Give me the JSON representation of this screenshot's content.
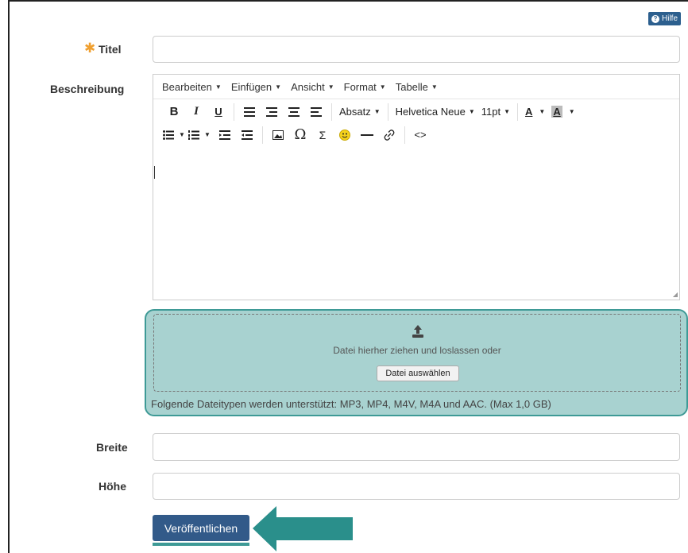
{
  "help": {
    "label": "Hilfe"
  },
  "form": {
    "title_label": "Titel",
    "description_label": "Beschreibung",
    "width_label": "Breite",
    "height_label": "Höhe"
  },
  "editor": {
    "menu": [
      "Bearbeiten",
      "Einfügen",
      "Ansicht",
      "Format",
      "Tabelle"
    ],
    "toolbar": {
      "bold": "B",
      "italic": "I",
      "underline": "U",
      "paragraph": "Absatz",
      "font_family": "Helvetica Neue",
      "font_size": "11pt",
      "text_color": "A",
      "bg_color": "A"
    },
    "row3": {
      "omega": "Ω",
      "sigma": "Σ",
      "code": "<>"
    }
  },
  "upload": {
    "drop_text": "Datei hierher ziehen und loslassen oder",
    "choose_button": "Datei auswählen",
    "supported_text": "Folgende Dateitypen werden unterstützt: MP3, MP4, M4V, M4A und AAC. (Max 1,0 GB)"
  },
  "actions": {
    "publish": "Veröffentlichen"
  },
  "colors": {
    "accent": "#3e9a96",
    "primary": "#325a89",
    "required": "#f0a030",
    "highlight_bg": "#a8d2d0"
  }
}
